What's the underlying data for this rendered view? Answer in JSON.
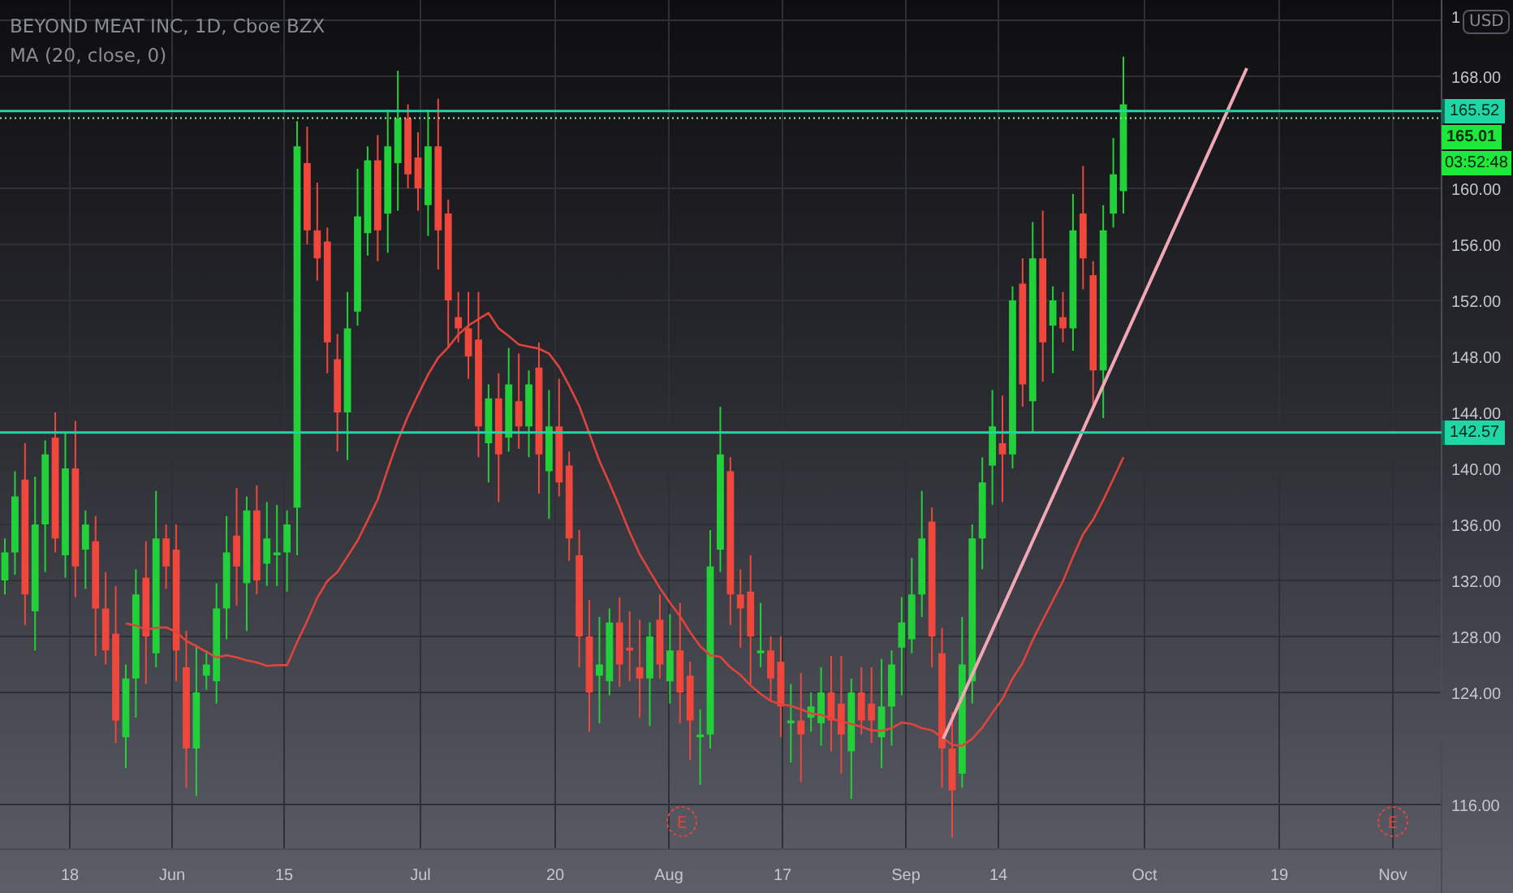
{
  "legend": {
    "title": "BEYOND MEAT INC, 1D, Cboe BZX",
    "indicator": "MA (20, close, 0)"
  },
  "price_axis": {
    "currency": "USD",
    "ticks": [
      "1",
      "168.00",
      "160.00",
      "156.00",
      "152.00",
      "148.00",
      "144.00",
      "140.00",
      "136.00",
      "132.00",
      "128.00",
      "124.00",
      "116.00"
    ]
  },
  "price_tags": [
    {
      "kind": "level",
      "text": "165.52",
      "color": "#1fd6a4"
    },
    {
      "kind": "last",
      "text": "165.01",
      "color": "#1ee83a"
    },
    {
      "kind": "countdown",
      "text": "03:52:48",
      "color": "#1ee83a"
    },
    {
      "kind": "level",
      "text": "142.57",
      "color": "#1fd6a4"
    }
  ],
  "time_axis": [
    "18",
    "Jun",
    "15",
    "Jul",
    "20",
    "Aug",
    "17",
    "Sep",
    "14",
    "Oct",
    "19",
    "Nov"
  ],
  "earnings_markers": [
    "E",
    "E"
  ]
}
